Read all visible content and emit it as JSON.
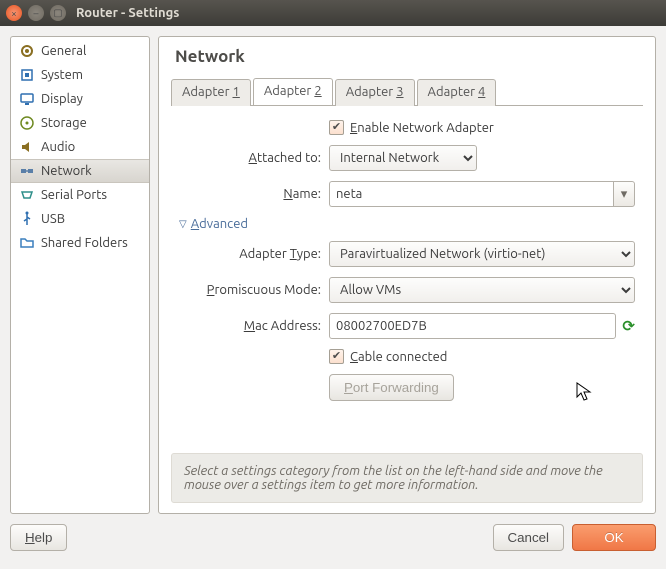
{
  "window": {
    "title": "Router - Settings"
  },
  "sidebar": {
    "items": [
      {
        "label": "General"
      },
      {
        "label": "System"
      },
      {
        "label": "Display"
      },
      {
        "label": "Storage"
      },
      {
        "label": "Audio"
      },
      {
        "label": "Network"
      },
      {
        "label": "Serial Ports"
      },
      {
        "label": "USB"
      },
      {
        "label": "Shared Folders"
      }
    ],
    "selected_index": 5
  },
  "panel": {
    "heading": "Network",
    "tabs": [
      {
        "prefix": "Adapter ",
        "n": "1"
      },
      {
        "prefix": "Adapter ",
        "n": "2"
      },
      {
        "prefix": "Adapter ",
        "n": "3"
      },
      {
        "prefix": "Adapter ",
        "n": "4"
      }
    ],
    "active_tab_index": 1
  },
  "form": {
    "enable_checked": true,
    "enable_label_pre": "E",
    "enable_label_post": "nable Network Adapter",
    "attached_label_pre": "A",
    "attached_label_post": "ttached to:",
    "attached_value": "Internal Network",
    "name_label_pre": "N",
    "name_label_post": "ame:",
    "name_value": "neta",
    "advanced_label_pre": "A",
    "advanced_label_post": "dvanced",
    "adapter_type_label_pre": "Adapter ",
    "adapter_type_label_u": "T",
    "adapter_type_label_post": "ype:",
    "adapter_type_value": "Paravirtualized Network (virtio-net)",
    "promisc_label_pre": "P",
    "promisc_label_post": "romiscuous Mode:",
    "promisc_value": "Allow VMs",
    "mac_label_pre": "M",
    "mac_label_post": "ac Address:",
    "mac_value": "08002700ED7B",
    "cable_checked": true,
    "cable_label_pre": "C",
    "cable_label_post": "able connected",
    "port_fwd_label_pre": "P",
    "port_fwd_label_post": "ort Forwarding"
  },
  "hint": "Select a settings category from the list on the left-hand side and move the mouse over a settings item to get more information.",
  "footer": {
    "help": "Help",
    "cancel": "Cancel",
    "ok": "OK"
  }
}
